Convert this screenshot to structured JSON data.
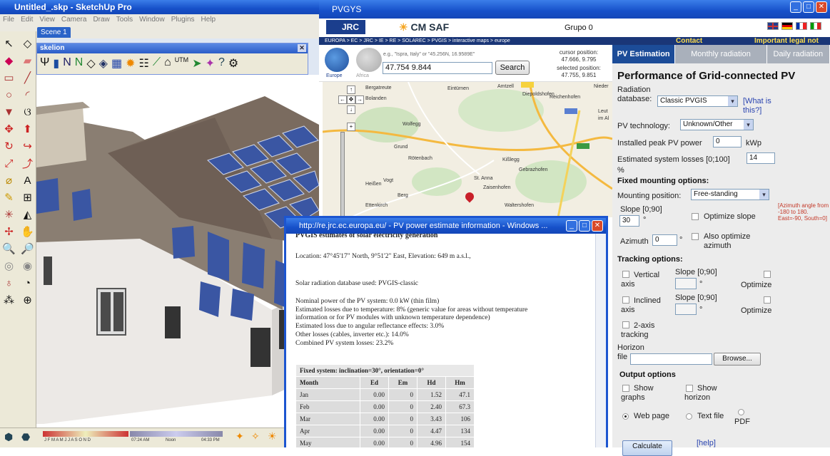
{
  "sketchup": {
    "title": "Untitled_.skp - SketchUp Pro",
    "menu": [
      "File",
      "Edit",
      "View",
      "Camera",
      "Draw",
      "Tools",
      "Window",
      "Plugins",
      "Help"
    ],
    "scene_tab": "Scene 1",
    "plugin_title": "skelion",
    "status": {
      "months": "J F M A M J J A S O N D",
      "time1": "07:24 AM",
      "noon": "Noon",
      "time2": "04:33 PM"
    }
  },
  "browser": {
    "title": "PVGYS",
    "logo1": "JRC",
    "logo2": "CM SAF",
    "group": "Grupo 0",
    "breadcrumb": "EUROPA > EC > JRC > IE > RE > SOLAREC > PVGIS > interactive maps > europe",
    "contact": "Contact",
    "legal": "Important legal not",
    "search": {
      "label_europe": "Europe",
      "label_africa": "Africa",
      "example": "e.g., \"Ispra, Italy\" or \"45.256N, 16.9589E\"",
      "value": "47.754 9.844",
      "button": "Search",
      "cursor_label": "cursor position:",
      "cursor_value": "47.666, 9.795",
      "selected_label": "selected position:",
      "selected_value": "47.755, 9.851"
    },
    "map_labels": [
      "Bergatreute",
      "Bolanden",
      "Eintürnen",
      "Amtzell",
      "Diepoldshofen",
      "Reichenhofen",
      "Wolfegg",
      "Grund",
      "Rötenbach",
      "Kißlegg",
      "Vogt",
      "St. Anna",
      "Gebrazhofen",
      "Heißen",
      "Berg",
      "Zaisenhofen",
      "Ettenkirch",
      "Waltershofen",
      "Leut",
      "im Al",
      "Nieder"
    ]
  },
  "form": {
    "tabs": [
      "PV Estimation",
      "Monthly radiation",
      "Daily radiation"
    ],
    "heading": "Performance of Grid-connected PV",
    "radiation_label": "Radiation database:",
    "radiation_value": "Classic PVGIS",
    "what_is_this": "[What is this?]",
    "tech_label": "PV technology:",
    "tech_value": "Unknown/Other",
    "peak_label": "Installed peak PV power",
    "peak_value": "0",
    "peak_unit": "kWp",
    "losses_label": "Estimated system losses [0;100]",
    "losses_value": "14",
    "losses_unit": "%",
    "fixed_heading": "Fixed mounting options:",
    "mount_label": "Mounting position:",
    "mount_value": "Free-standing",
    "azimuth_note": "[Azimuth angle from -180 to 180. East=-90, South=0]",
    "slope_label": "Slope [0;90]",
    "slope_value": "30",
    "slope_unit": "°",
    "optimize_slope": "Optimize slope",
    "azimuth_label": "Azimuth",
    "azimuth_value": "0",
    "azimuth_unit": "°",
    "also_optimize": "Also optimize azimuth",
    "tracking_heading": "Tracking options:",
    "vertical_axis": "Vertical axis",
    "inclined_axis": "Inclined axis",
    "two_axis": "2-axis tracking",
    "optimize": "Optimize",
    "horizon_label": "Horizon file",
    "browse": "Browse...",
    "output_heading": "Output options",
    "show_graphs": "Show graphs",
    "show_horizon": "Show horizon",
    "web_page": "Web page",
    "text_file": "Text file",
    "pdf": "PDF",
    "calculate": "Calculate",
    "help": "[help]"
  },
  "popup": {
    "title": "http://re.jrc.ec.europa.eu/ - PV power estimate information - Windows ...",
    "heading": "PVGIS estimates of solar electricity generation",
    "location": "Location: 47°45'17\" North, 9°51'2\" East, Elevation: 649 m a.s.l.,",
    "database": "Solar radiation database used: PVGIS-classic",
    "lines": [
      "Nominal power of the PV system: 0.0 kW (thin film)",
      "Estimated losses due to temperature: 8% (generic value for areas without temperature",
      "information or for PV modules with unknown temperature dependence)",
      "Estimated loss due to angular reflectance effects: 3.0%",
      "Other losses (cables, inverter etc.): 14.0%",
      "Combined PV system losses: 23.2%"
    ],
    "table": {
      "caption": "Fixed system: inclination=30°, orientation=0°",
      "headers": [
        "Month",
        "Ed",
        "Em",
        "Hd",
        "Hm"
      ],
      "rows": [
        [
          "Jan",
          "0.00",
          "0",
          "1.52",
          "47.1"
        ],
        [
          "Feb",
          "0.00",
          "0",
          "2.40",
          "67.3"
        ],
        [
          "Mar",
          "0.00",
          "0",
          "3.43",
          "106"
        ],
        [
          "Apr",
          "0.00",
          "0",
          "4.47",
          "134"
        ],
        [
          "May",
          "0.00",
          "0",
          "4.96",
          "154"
        ]
      ]
    }
  }
}
